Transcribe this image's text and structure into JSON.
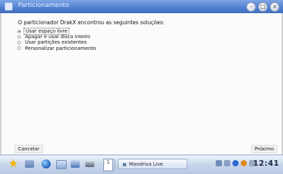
{
  "window": {
    "title": "Particionamento"
  },
  "dialog": {
    "heading": "O particionador DrakX encontrou as seguintes soluções:",
    "options": [
      {
        "label": "Usar espaço livre",
        "selected": true
      },
      {
        "label": "Apagar e usar disco inteiro",
        "selected": false
      },
      {
        "label": "Usar partições existentes",
        "selected": false
      },
      {
        "label": "Personalizar particionamento",
        "selected": false
      }
    ],
    "cancel_label": "Cancelar",
    "next_label": "Próximo"
  },
  "taskbar": {
    "pager_label": "1",
    "task_label": "Mandriva Live",
    "clock": "12:41"
  }
}
